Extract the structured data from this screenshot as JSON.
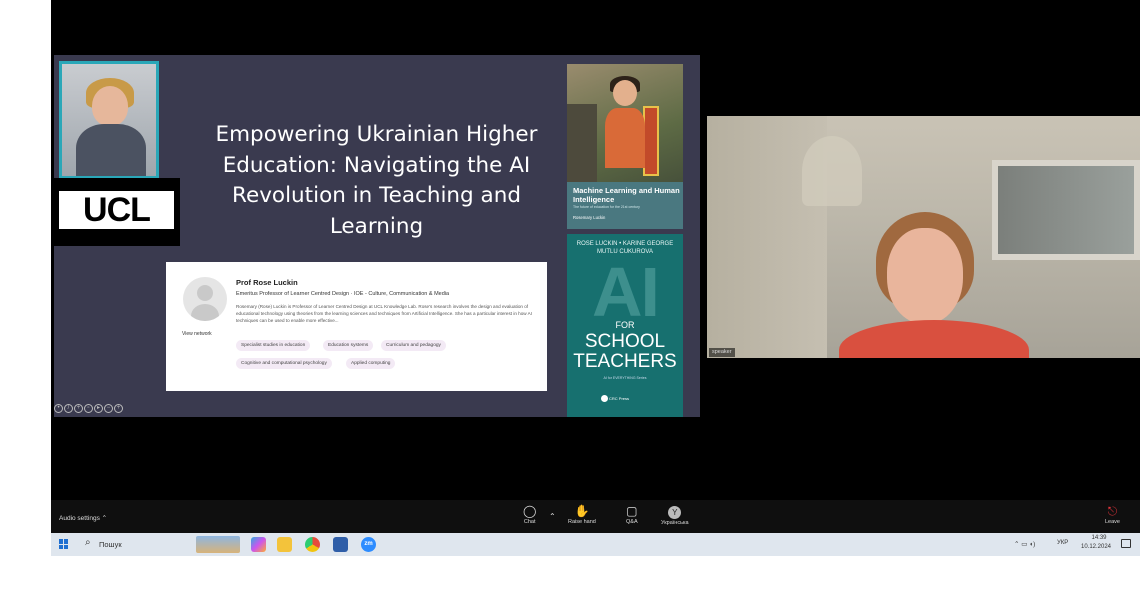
{
  "slide": {
    "title": "Empowering Ukrainian Higher Education: Navigating the AI Revolution in Teaching and Learning",
    "logo_text": "UCL",
    "profile": {
      "name": "Prof Rose Luckin",
      "role": "Emeritus Professor of Learner Centred Design  ·  IOE - Culture, Communication & Media",
      "bio": "Rosemary (Rose) Luckin is Professor of Learner Centred Design at UCL Knowledge Lab. Rose's research involves the design and evaluation of educational technology using theories from the learning sciences and techniques from Artificial Intelligence. She has a particular interest in how AI techniques can be used to enable more effective...",
      "network_link": "View network",
      "tags": [
        "Specialist studies in education",
        "Education systems",
        "Curriculum and pedagogy",
        "Cognitive and computational psychology",
        "Applied computing"
      ]
    },
    "book1": {
      "title": "Machine Learning and Human Intelligence",
      "subtitle": "The future of education for the 21st century",
      "author": "Rosemary Luckin"
    },
    "book2": {
      "authors": "ROSE LUCKIN • KARINE GEORGE MUTLU CUKUROVA",
      "big": "AI",
      "for": "FOR",
      "school": "SCHOOL",
      "teachers": "TEACHERS",
      "series": "AI for EVERYTHING Series",
      "publisher": "CRC Press"
    }
  },
  "video": {
    "speaker_label": "speaker"
  },
  "meeting_bar": {
    "audio_settings": "Audio settings",
    "buttons": [
      {
        "label": "Chat",
        "icon": "chat-icon"
      },
      {
        "label": "Raise hand",
        "icon": "hand-icon"
      },
      {
        "label": "Q&A",
        "icon": "qa-icon"
      },
      {
        "label": "Українська",
        "icon": "language-icon",
        "glyph": "Y"
      },
      {
        "label": "Leave",
        "icon": "leave-icon"
      }
    ],
    "colors": {
      "leave": "#e0343b"
    }
  },
  "taskbar": {
    "search_label": "Пошук",
    "tray_language": "УКР",
    "time": "14:39",
    "date": "10.12.2024",
    "apps": [
      "copilot-icon",
      "file-explorer-icon",
      "chrome-icon",
      "notes-icon",
      "zoom-icon"
    ],
    "zoom_glyph": "zm"
  }
}
